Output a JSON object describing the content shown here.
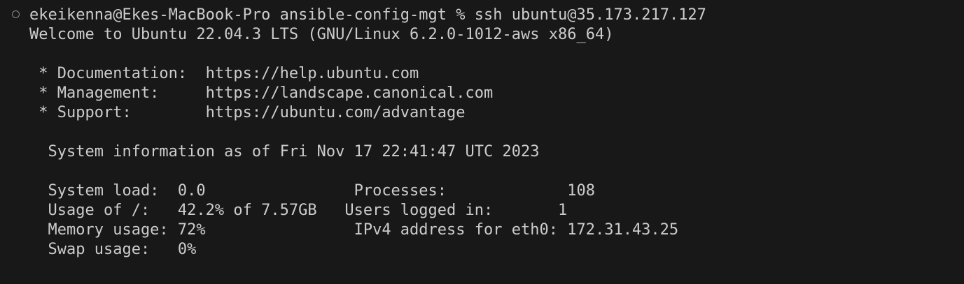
{
  "terminal": {
    "prompt_user_host": "ekeikenna@Ekes-MacBook-Pro",
    "prompt_dir": "ansible-config-mgt",
    "prompt_symbol": "%",
    "command": "ssh ubuntu@35.173.217.127",
    "colors": {
      "background": "#181818",
      "foreground": "#cccccc",
      "marker": "#8a8a8a"
    }
  },
  "output": {
    "welcome": "Welcome to Ubuntu 22.04.3 LTS (GNU/Linux 6.2.0-1012-aws x86_64)",
    "documentation": " * Documentation:  https://help.ubuntu.com",
    "management": " * Management:     https://landscape.canonical.com",
    "support": " * Support:        https://ubuntu.com/advantage",
    "sysinfo_header": "  System information as of Fri Nov 17 22:41:47 UTC 2023",
    "sysinfo_row1": "  System load:  0.0                Processes:             108",
    "sysinfo_row2": "  Usage of /:   42.2% of 7.57GB   Users logged in:       1",
    "sysinfo_row3": "  Memory usage: 72%                IPv4 address for eth0: 172.31.43.25",
    "sysinfo_row4": "  Swap usage:   0%"
  }
}
